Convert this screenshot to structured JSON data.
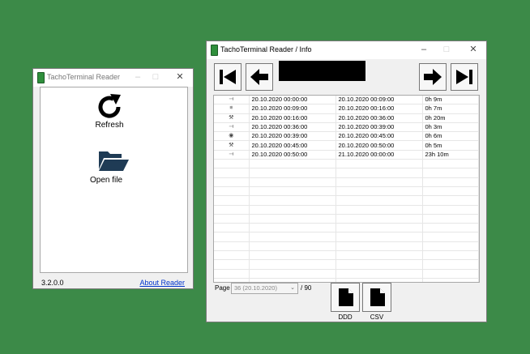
{
  "reader_window": {
    "title": "TachoTerminal Reader",
    "controls": {
      "minimize": "–",
      "maximize": "□",
      "close": "✕"
    },
    "refresh_label": "Refresh",
    "open_file_label": "Open file",
    "version": "3.2.0.0",
    "about_link": "About Reader"
  },
  "info_window": {
    "title": "TachoTerminal Reader / Info",
    "controls": {
      "minimize": "–",
      "maximize": "□",
      "close": "✕"
    },
    "rows": [
      {
        "icon": "rest-icon",
        "glyph": "⟞",
        "start": "20.10.2020 00:00:00",
        "end": "20.10.2020 00:09:00",
        "duration": "0h 9m"
      },
      {
        "icon": "work-icon",
        "glyph": "␧",
        "start": "20.10.2020 00:09:00",
        "end": "20.10.2020 00:16:00",
        "duration": "0h 7m"
      },
      {
        "icon": "availability-icon",
        "glyph": "⚒",
        "start": "20.10.2020 00:16:00",
        "end": "20.10.2020 00:36:00",
        "duration": "0h 20m"
      },
      {
        "icon": "rest-icon",
        "glyph": "⟞",
        "start": "20.10.2020 00:36:00",
        "end": "20.10.2020 00:39:00",
        "duration": "0h 3m"
      },
      {
        "icon": "driving-icon",
        "glyph": "◉",
        "start": "20.10.2020 00:39:00",
        "end": "20.10.2020 00:45:00",
        "duration": "0h 6m"
      },
      {
        "icon": "availability-icon",
        "glyph": "⚒",
        "start": "20.10.2020 00:45:00",
        "end": "20.10.2020 00:50:00",
        "duration": "0h 5m"
      },
      {
        "icon": "rest-icon",
        "glyph": "⟞",
        "start": "20.10.2020 00:50:00",
        "end": "21.10.2020 00:00:00",
        "duration": "23h 10m"
      }
    ],
    "empty_rows": 14,
    "page_label": "Page",
    "page_selected": "36 (20.10.2020)",
    "page_total": "/ 90",
    "ddd_label": "DDD",
    "csv_label": "CSV"
  }
}
